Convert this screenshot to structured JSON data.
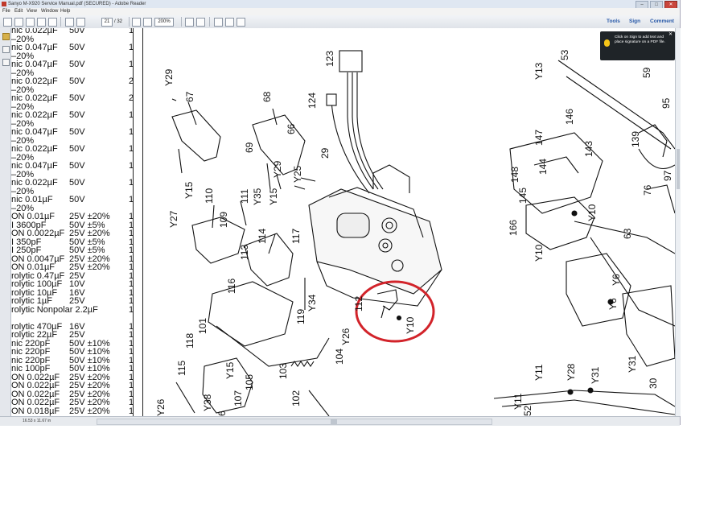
{
  "window": {
    "title": "Sanyo M-X920 Service Manual.pdf (SECURED) - Adobe Reader",
    "controls": [
      "–",
      "□",
      "✕"
    ]
  },
  "menu": [
    "File",
    "Edit",
    "View",
    "Window",
    "Help"
  ],
  "toolbar": {
    "page_current": "21",
    "page_total": "/ 32",
    "zoom": "200%",
    "tools_label": "Tools",
    "sign_label": "Sign",
    "comment_label": "Comment"
  },
  "tooltip": {
    "text": "Click on Sign to add text and place signature on a PDF file."
  },
  "status": {
    "page_size": "16.53 x 11.67 in"
  },
  "parts_list": [
    {
      "desc": "nic 0.022µF",
      "value": "50V",
      "qty": "1"
    },
    {
      "desc": "–20%",
      "value": "",
      "qty": ""
    },
    {
      "desc": "nic 0.047µF",
      "value": "50V",
      "qty": "1"
    },
    {
      "desc": "–20%",
      "value": "",
      "qty": ""
    },
    {
      "desc": "nic 0.047µF",
      "value": "50V",
      "qty": "1"
    },
    {
      "desc": "–20%",
      "value": "",
      "qty": ""
    },
    {
      "desc": "nic 0.022µF",
      "value": "50V",
      "qty": "2"
    },
    {
      "desc": "–20%",
      "value": "",
      "qty": ""
    },
    {
      "desc": "nic 0.022µF",
      "value": "50V",
      "qty": "2"
    },
    {
      "desc": "–20%",
      "value": "",
      "qty": ""
    },
    {
      "desc": "nic 0.022µF",
      "value": "50V",
      "qty": "1"
    },
    {
      "desc": "–20%",
      "value": "",
      "qty": ""
    },
    {
      "desc": "nic 0.047µF",
      "value": "50V",
      "qty": "1"
    },
    {
      "desc": "–20%",
      "value": "",
      "qty": ""
    },
    {
      "desc": "nic 0.022µF",
      "value": "50V",
      "qty": "1"
    },
    {
      "desc": "–20%",
      "value": "",
      "qty": ""
    },
    {
      "desc": "nic 0.047µF",
      "value": "50V",
      "qty": "1"
    },
    {
      "desc": "–20%",
      "value": "",
      "qty": ""
    },
    {
      "desc": "nic 0.022µF",
      "value": "50V",
      "qty": "1"
    },
    {
      "desc": "–20%",
      "value": "",
      "qty": ""
    },
    {
      "desc": "nic 0.01µF",
      "value": "50V",
      "qty": "1"
    },
    {
      "desc": "–20%",
      "value": "",
      "qty": ""
    },
    {
      "desc": "ON 0.01µF",
      "value": "25V ±20%",
      "qty": "1"
    },
    {
      "desc": "I 3600pF",
      "value": "50V ±5%",
      "qty": "1"
    },
    {
      "desc": "ON 0.0022µF",
      "value": "25V ±20%",
      "qty": "1"
    },
    {
      "desc": "I 350pF",
      "value": "50V ±5%",
      "qty": "1"
    },
    {
      "desc": "I 250pF",
      "value": "50V ±5%",
      "qty": "1"
    },
    {
      "desc": "ON 0.0047µF",
      "value": "25V ±20%",
      "qty": "1"
    },
    {
      "desc": "ON 0.01µF",
      "value": "25V ±20%",
      "qty": "1"
    },
    {
      "desc": "rolytic 0.47µF",
      "value": "25V",
      "qty": "1"
    },
    {
      "desc": "rolytic 100µF",
      "value": "10V",
      "qty": "1"
    },
    {
      "desc": "rolytic 10µF",
      "value": "16V",
      "qty": "1"
    },
    {
      "desc": "rolytic 1µF",
      "value": "25V",
      "qty": "1"
    },
    {
      "desc": "rolytic Nonpolar 2.2µF",
      "value": "",
      "qty": "1"
    },
    {
      "desc": "",
      "value": "",
      "qty": ""
    },
    {
      "desc": "rolytic 470µF",
      "value": "16V",
      "qty": "1"
    },
    {
      "desc": "rolytic 22µF",
      "value": "25V",
      "qty": "1"
    },
    {
      "desc": "nic 220pF",
      "value": "50V ±10%",
      "qty": "1"
    },
    {
      "desc": "nic 220pF",
      "value": "50V ±10%",
      "qty": "1"
    },
    {
      "desc": "nic 220pF",
      "value": "50V ±10%",
      "qty": "1"
    },
    {
      "desc": "nic 100pF",
      "value": "50V ±10%",
      "qty": "1"
    },
    {
      "desc": "ON 0.022µF",
      "value": "25V ±20%",
      "qty": "1"
    },
    {
      "desc": "ON 0.022µF",
      "value": "25V ±20%",
      "qty": "1"
    },
    {
      "desc": "ON 0.022µF",
      "value": "25V ±20%",
      "qty": "1"
    },
    {
      "desc": "ON 0.022µF",
      "value": "25V ±20%",
      "qty": "1"
    },
    {
      "desc": "ON 0.018µF",
      "value": "25V ±20%",
      "qty": "1"
    }
  ],
  "diagram_labels": {
    "l123": "123",
    "l124": "124",
    "l68": "68",
    "l67": "67",
    "l66": "66",
    "l69": "69",
    "lY29a": "Y29",
    "lY29b": "Y29",
    "l29": "29",
    "lY25": "Y25",
    "l110": "110",
    "l111": "111",
    "lY35": "Y35",
    "lY15a": "Y15",
    "lY15b": "Y15",
    "l109": "109",
    "lY27": "Y27",
    "l113": "113",
    "l114": "114",
    "l117": "117",
    "l116": "116",
    "l112": "112",
    "lY10a": "Y10",
    "lY34": "Y34",
    "l119": "119",
    "l101": "101",
    "l118": "118",
    "l104": "104",
    "lY26a": "Y26",
    "l115": "115",
    "lY15c": "Y15",
    "l105": "105",
    "l103": "103",
    "lY38": "Y38",
    "l107": "107",
    "l102": "102",
    "lY26b": "Y26",
    "l6": "6",
    "l53": "53",
    "lY13": "Y13",
    "l59": "59",
    "l95": "95",
    "l146": "146",
    "l147": "147",
    "l143": "143",
    "l139": "139",
    "l97": "97",
    "l144": "144",
    "l148": "148",
    "l145": "145",
    "l76": "76",
    "l166": "166",
    "lY10b": "Y10",
    "l63": "63",
    "lY10c": "Y10",
    "lY6a": "Y6",
    "lY6b": "Y6",
    "lY11a": "Y11",
    "lY28": "Y28",
    "lY31a": "Y31",
    "lY31b": "Y31",
    "l30": "30",
    "lY11b": "Y11",
    "l52": "52"
  }
}
